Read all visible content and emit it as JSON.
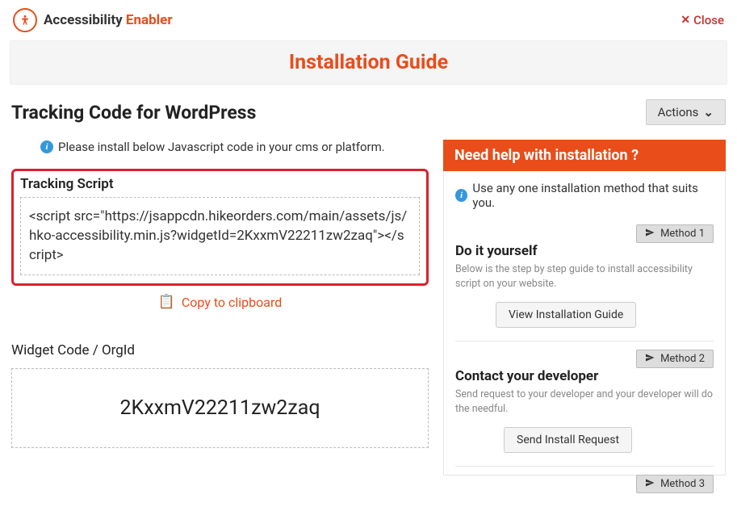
{
  "brand": {
    "name_dark": "Accessibility",
    "name_orange": "Enabler"
  },
  "close_label": "Close",
  "page_title": "Installation Guide",
  "section_heading": "Tracking Code for WordPress",
  "actions_label": "Actions",
  "install_hint": "Please install below Javascript code in your cms or platform.",
  "tracking": {
    "box_title": "Tracking Script",
    "script_text": "<script src=\"https://jsappcdn.hikeorders.com/main/assets/js/hko-accessibility.min.js?widgetId=2KxxmV22211zw2zaq\"></script>",
    "copy_label": "Copy to clipboard"
  },
  "widget": {
    "label": "Widget Code / OrgId",
    "value": "2KxxmV22211zw2zaq"
  },
  "help": {
    "heading": "Need help with installation ?",
    "intro": "Use any one installation method that suits you.",
    "methods": [
      {
        "badge": "Method 1",
        "title": "Do it yourself",
        "desc": "Below is the step by step guide to install accessibility script on your website.",
        "button": "View Installation Guide"
      },
      {
        "badge": "Method 2",
        "title": "Contact your developer",
        "desc": "Send request to your developer and your developer will do the needful.",
        "button": "Send Install Request"
      },
      {
        "badge": "Method 3"
      }
    ]
  }
}
